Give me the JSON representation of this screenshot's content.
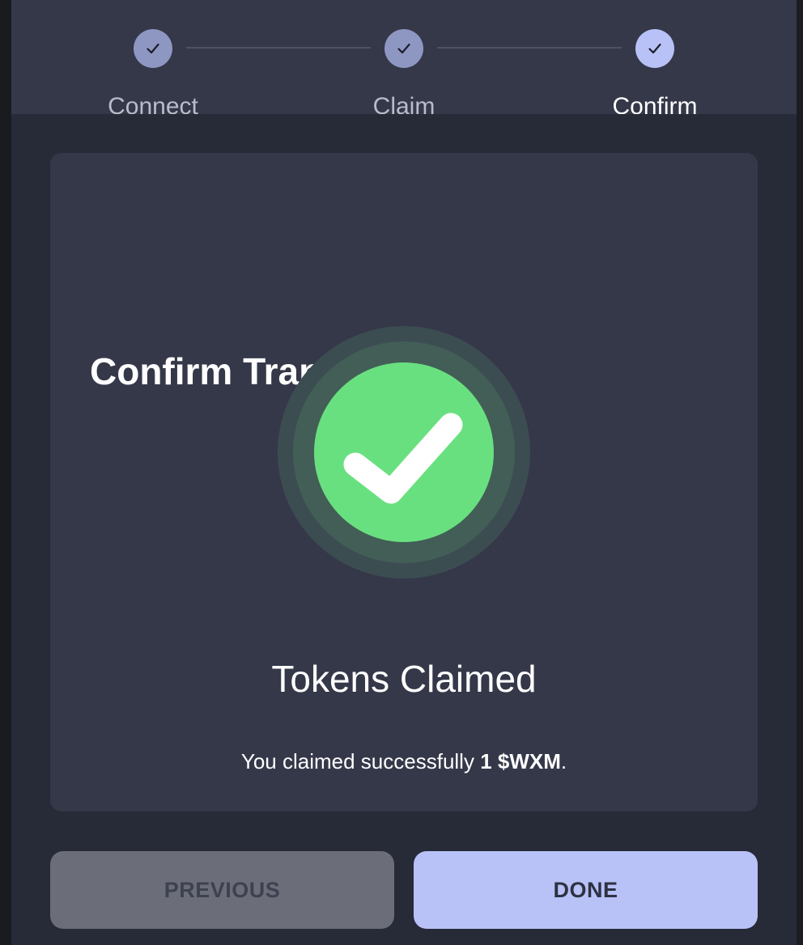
{
  "stepper": {
    "steps": [
      {
        "label": "Connect",
        "state": "done"
      },
      {
        "label": "Claim",
        "state": "done"
      },
      {
        "label": "Confirm",
        "state": "active"
      }
    ],
    "step_icon": "check-icon"
  },
  "card": {
    "title": "Confirm Transaction",
    "status_icon": "success-check-icon",
    "status_title": "Tokens Claimed",
    "message_prefix": "You claimed successfully ",
    "message_amount": "1 $WXM",
    "message_suffix": "."
  },
  "buttons": {
    "previous_label": "PREVIOUS",
    "done_label": "DONE"
  },
  "colors": {
    "accent": "#b8c2f7",
    "step_done": "#8e97c2",
    "success_green": "#69e07f",
    "card_bg": "#353849",
    "page_bg": "#272a37"
  }
}
